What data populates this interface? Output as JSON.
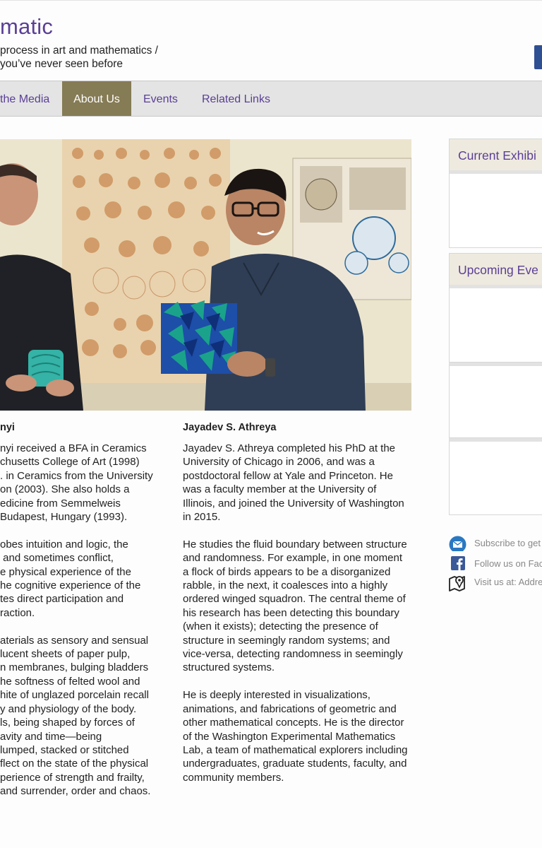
{
  "header": {
    "site_title": "matic",
    "tagline_line1": "process in art and mathematics /",
    "tagline_line2": "you’ve never seen before"
  },
  "nav": {
    "items": [
      {
        "label": "the Media",
        "active": false
      },
      {
        "label": "About Us",
        "active": true
      },
      {
        "label": "Events",
        "active": false
      },
      {
        "label": "Related Links",
        "active": false
      }
    ]
  },
  "sidebar": {
    "current_exhibit_title": "Current Exhibi",
    "upcoming_events_title": "Upcoming Eve",
    "contacts": {
      "subscribe": "Subscribe to get",
      "facebook": "Follow us on Fac",
      "visit": "Visit us at: Addre"
    }
  },
  "left_person": {
    "name": "nyi",
    "paragraphs": [
      [
        "nyi received a BFA in Ceramics",
        "chusetts College of Art (1998)",
        ". in Ceramics from the University",
        "on (2003). She also holds a",
        "edicine from Semmelweis",
        "Budapest, Hungary (1993)."
      ],
      [
        "obes intuition and logic, the",
        " and sometimes conflict,",
        "e physical experience of the",
        "he cognitive experience of the",
        "tes direct participation and",
        "raction."
      ],
      [
        "aterials as sensory and sensual",
        "lucent sheets of paper pulp,",
        "n membranes, bulging bladders",
        "he softness of felted wool and",
        "hite of unglazed porcelain recall",
        "y and physiology of the body.",
        "ls, being shaped by forces of",
        "avity and time—being",
        "lumped, stacked or stitched",
        "flect on the state of the physical",
        "perience of strength and frailty,",
        "and surrender, order and chaos."
      ]
    ]
  },
  "right_person": {
    "name": "Jayadev S. Athreya",
    "paragraphs": [
      "Jayadev S. Athreya completed his PhD at the University of Chicago in 2006, and was a postdoctoral fellow at Yale and Princeton. He was a faculty member at the University of Illinois, and joined the University of Washington in 2015.",
      "He studies the fluid boundary between structure and randomness. For example, in one moment a flock of birds appears to be a disorganized rabble, in the next, it coalesces into a highly ordered winged squadron. The central theme of his research has been detecting this boundary (when it exists); detecting the presence of structure in seemingly random systems; and vice-versa, detecting randomness in seemingly structured systems.",
      "He is deeply interested in visualizations, animations, and fabrications of geometric and other mathematical concepts. He is the director of the Washington Experimental Mathematics Lab, a team of mathematical explorers including undergraduates, graduate students, faculty, and community members."
    ]
  },
  "colors": {
    "brand_purple": "#5a3f96",
    "nav_active": "#857b55",
    "nav_bg": "#e4e4e4"
  }
}
